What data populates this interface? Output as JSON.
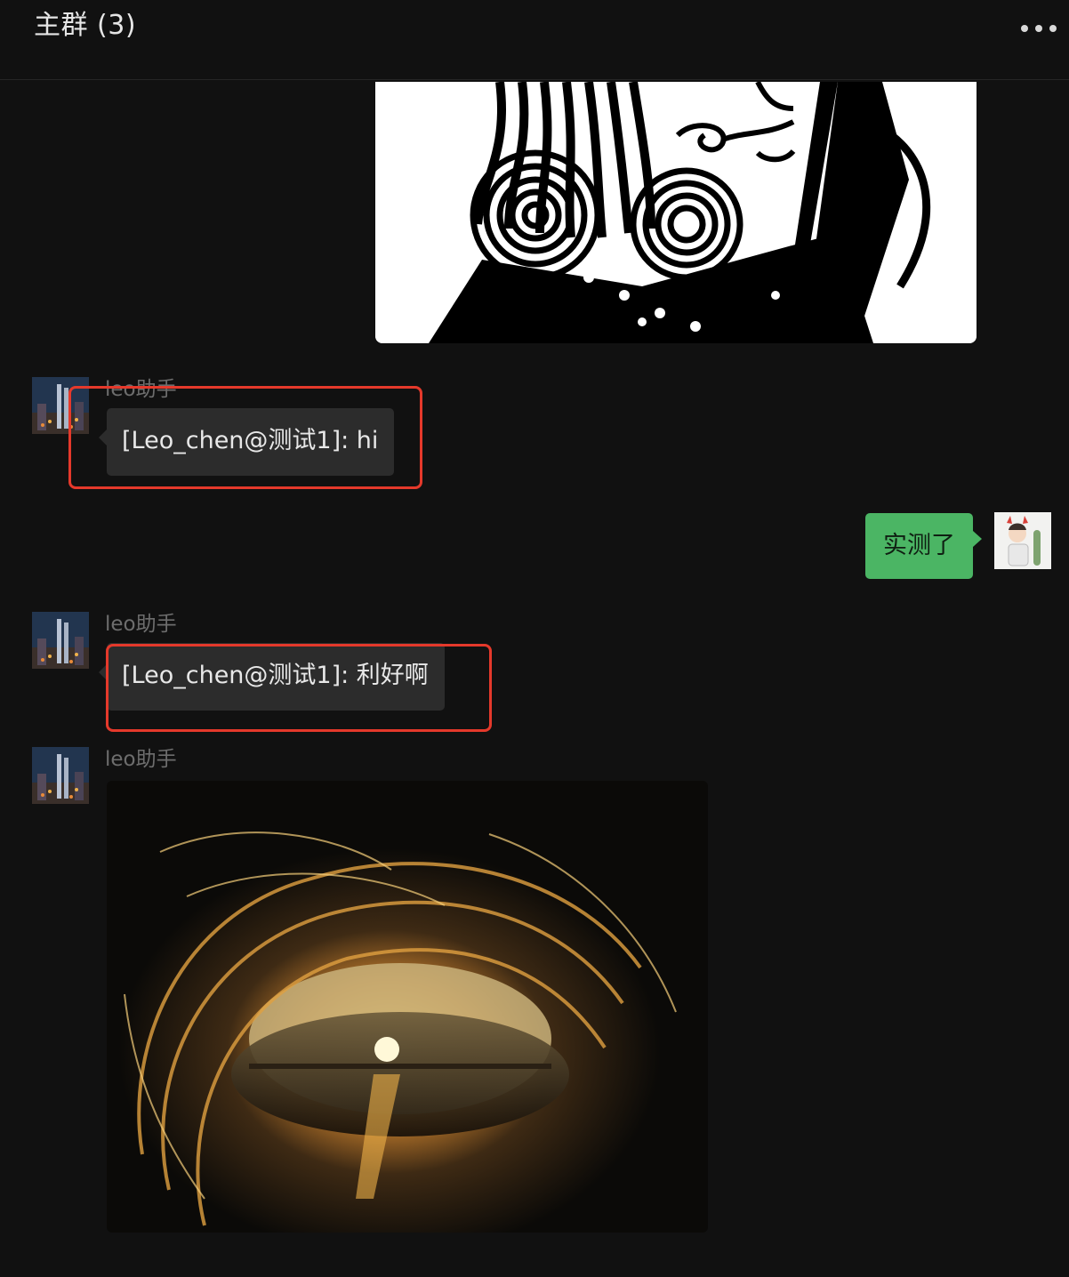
{
  "header": {
    "title": "主群 (3)",
    "more_icon": "more-icon"
  },
  "messages": [
    {
      "type": "image",
      "side": "right",
      "description_icon": "playing-card-king-image"
    },
    {
      "type": "text",
      "side": "left",
      "sender": "leo助手",
      "avatar_icon": "city-night-avatar",
      "text": "[Leo_chen@测试1]: hi",
      "highlighted": true
    },
    {
      "type": "text",
      "side": "right",
      "text": "实测了",
      "avatar_icon": "user-avatar"
    },
    {
      "type": "text",
      "side": "left",
      "sender": "leo助手",
      "avatar_icon": "city-night-avatar",
      "text": "[Leo_chen@测试1]: 利好啊",
      "highlighted": true
    },
    {
      "type": "image",
      "side": "left",
      "sender": "leo助手",
      "avatar_icon": "city-night-avatar",
      "description_icon": "sunset-wave-image"
    }
  ],
  "colors": {
    "background": "#111111",
    "incoming_bubble": "#2c2c2c",
    "outgoing_bubble": "#4bb564",
    "highlight_border": "#e5392b",
    "sender_text": "#6d6d6d"
  }
}
